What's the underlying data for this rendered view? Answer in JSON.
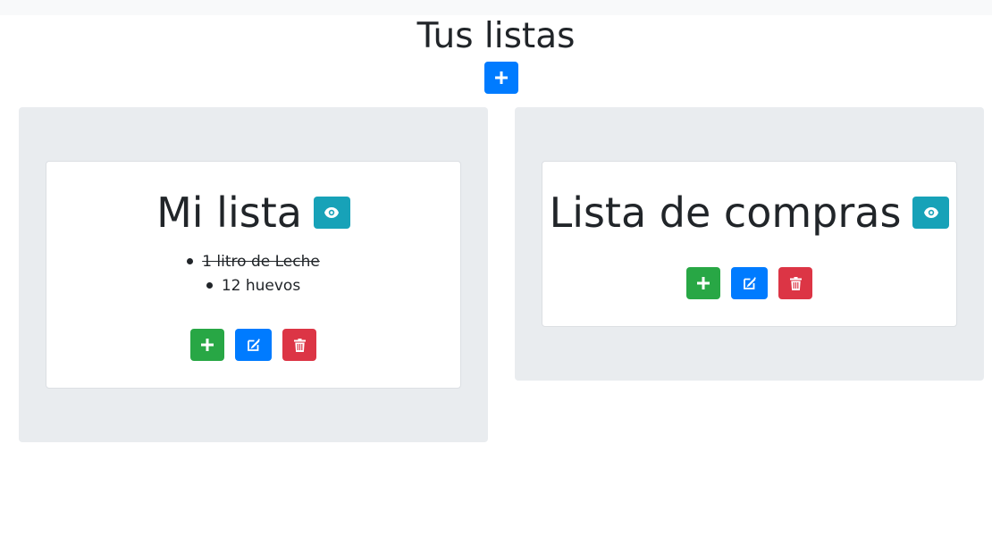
{
  "header": {
    "title": "Tus listas"
  },
  "icons": {
    "add": "plus-icon",
    "view": "eye-icon",
    "edit": "edit-icon",
    "delete": "trash-icon"
  },
  "colors": {
    "primary": "#007bff",
    "success": "#28a745",
    "danger": "#dc3545",
    "info": "#17a2b8",
    "jumbotron": "#e9ecef"
  },
  "lists": [
    {
      "title": "Mi lista",
      "items": [
        {
          "text": "1 litro de Leche",
          "done": true
        },
        {
          "text": "12 huevos",
          "done": false
        }
      ]
    },
    {
      "title": "Lista de compras",
      "items": []
    }
  ]
}
